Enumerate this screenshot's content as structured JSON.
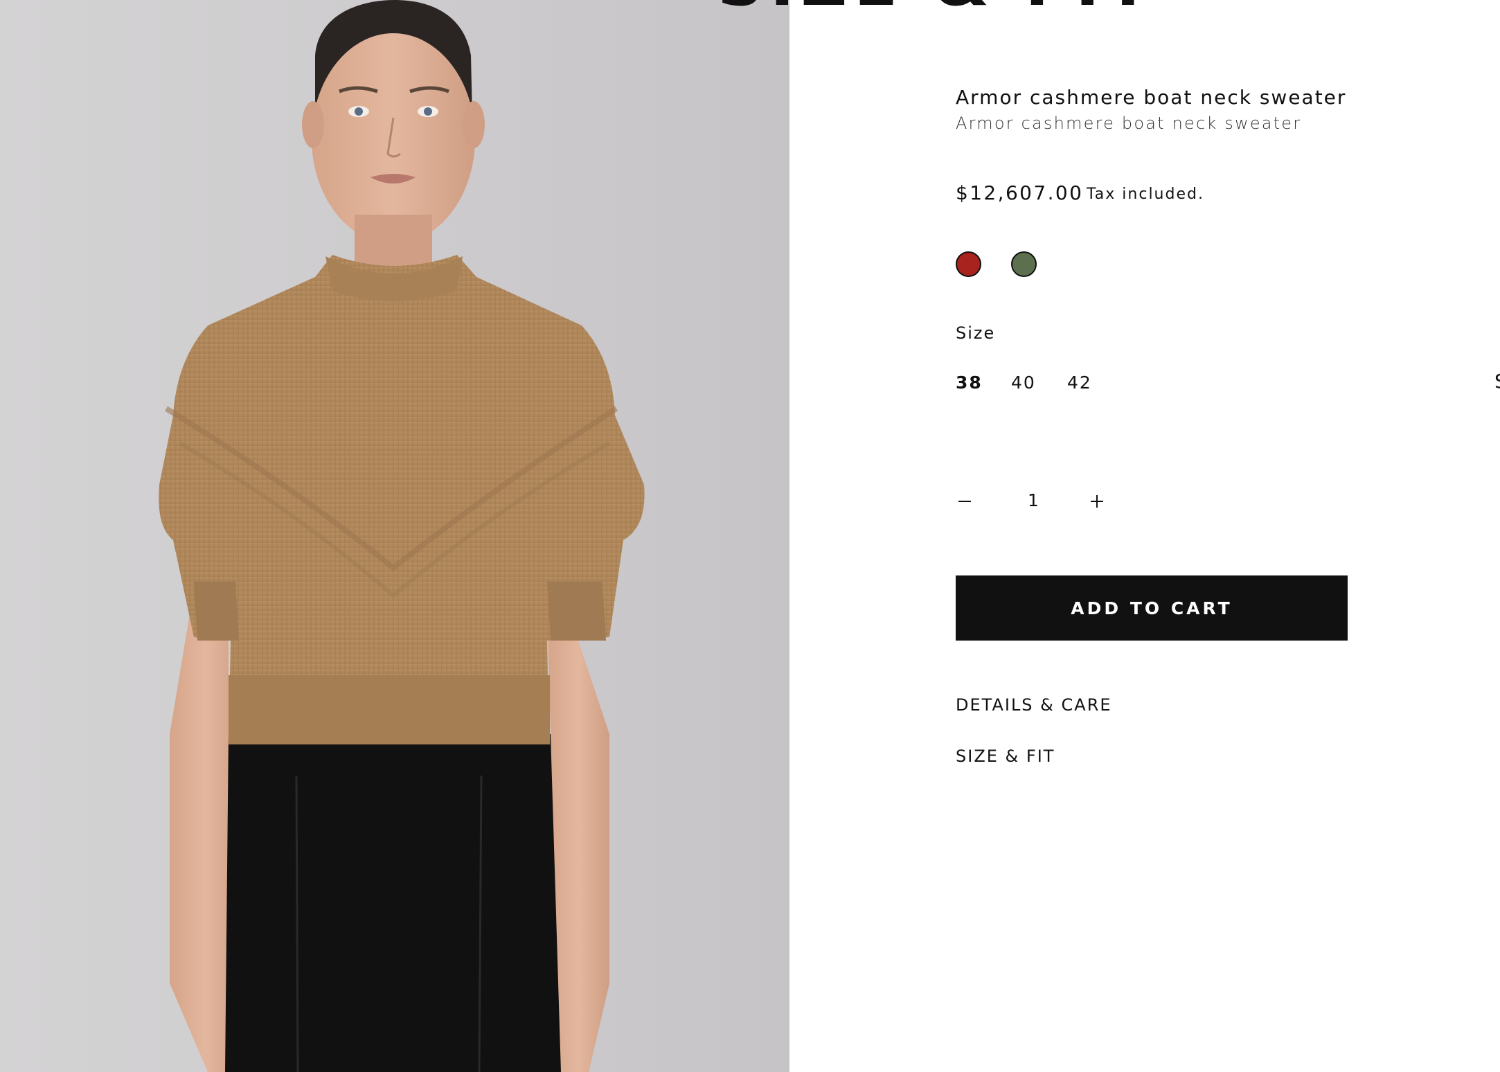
{
  "heading": "SIZE & FIT",
  "product": {
    "title": "Armor cashmere boat neck sweater",
    "subtitle": "Armor cashmere boat neck sweater",
    "price": "$12,607.00",
    "tax_note": "Tax included."
  },
  "colors": [
    {
      "name": "red",
      "hex": "#a8221e"
    },
    {
      "name": "green",
      "hex": "#5c7050"
    }
  ],
  "size": {
    "label": "Size",
    "options": [
      "38",
      "40",
      "42"
    ],
    "selected": "38"
  },
  "quantity": {
    "value": "1"
  },
  "actions": {
    "add_to_cart": "ADD TO CART"
  },
  "accordions": {
    "details": "DETAILS & CARE",
    "size_fit": "SIZE & FIT"
  },
  "edge_glyph": "S",
  "theme": {
    "button_bg": "#111111",
    "sweater": "#b38b60",
    "background": "#ffffff"
  }
}
